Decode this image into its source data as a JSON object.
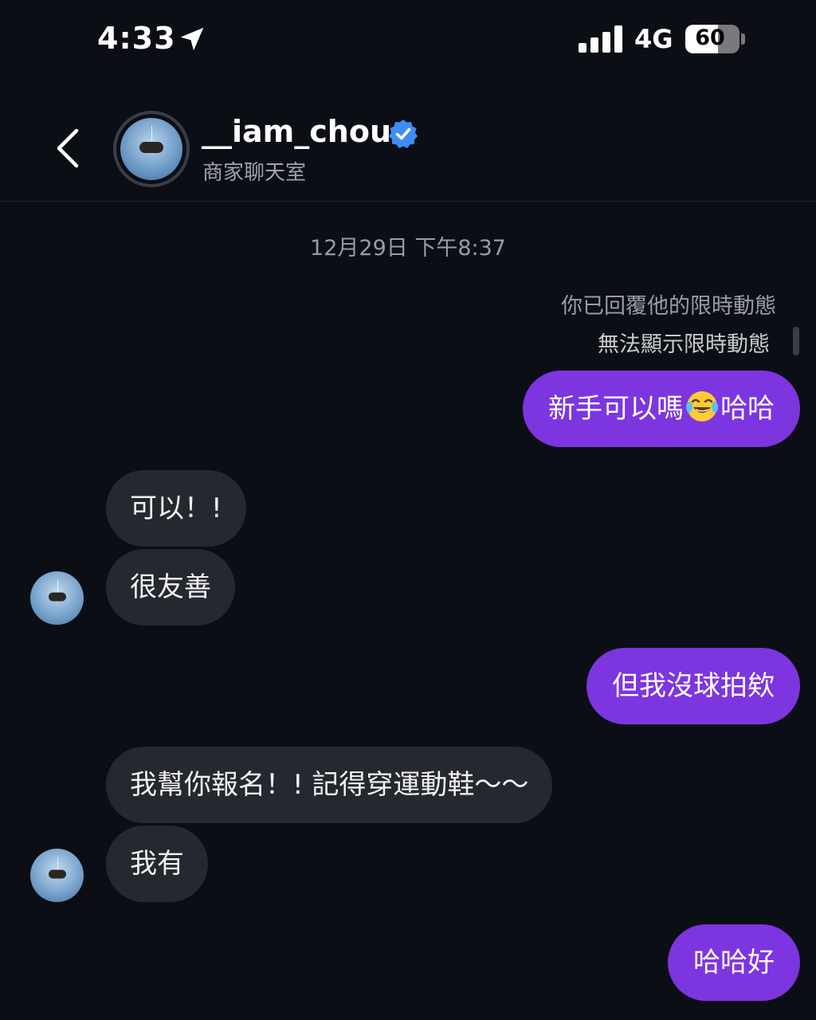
{
  "status_bar": {
    "time": "4:33",
    "network": "4G",
    "battery": "60",
    "battery_level": 0.6
  },
  "header": {
    "username": "__iam_chou",
    "subtitle": "商家聊天室",
    "verified": true
  },
  "chat": {
    "timestamp": "12月29日 下午8:37",
    "reply_note": "你已回覆他的限時動態",
    "story_unavailable": "無法顯示限時動態",
    "messages": [
      {
        "side": "out",
        "text_before": "新手可以嗎",
        "emoji": "face-with-tears-of-joy-icon",
        "text_after": "哈哈"
      },
      {
        "side": "in",
        "text": "可以！!"
      },
      {
        "side": "in",
        "text": "很友善"
      },
      {
        "side": "out",
        "text": "但我沒球拍欸"
      },
      {
        "side": "in",
        "text": "我幫你報名！! 記得穿運動鞋～～"
      },
      {
        "side": "in",
        "text": "我有"
      },
      {
        "side": "out",
        "text": "哈哈好"
      }
    ]
  },
  "colors": {
    "background": "#0c0e16",
    "outgoing_bubble": "#7d35e0",
    "incoming_bubble": "#262830",
    "verified": "#3f8cf5"
  }
}
